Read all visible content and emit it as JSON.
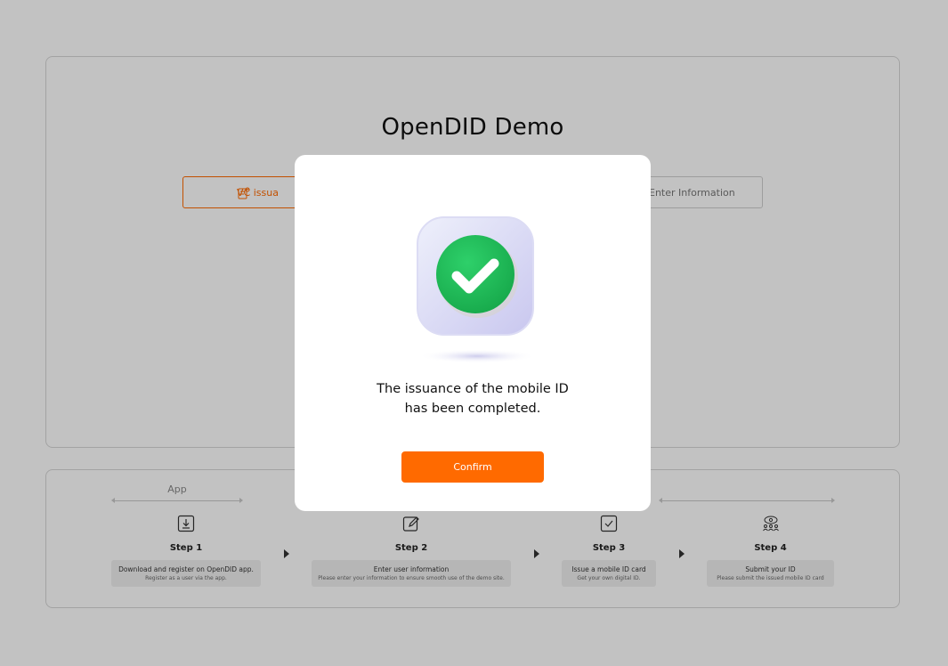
{
  "page": {
    "title": "OpenDID Demo"
  },
  "tabs": [
    {
      "label": "VC issuance",
      "visible_label": "VC issua",
      "active": true
    },
    {
      "label": "Enter Information",
      "active": false
    }
  ],
  "steps_section": {
    "group_label": "App",
    "steps": [
      {
        "title": "Step 1",
        "line1": "Download and register on OpenDID app.",
        "line2": "Register as a user via the app.",
        "icon": "download-icon"
      },
      {
        "title": "Step 2",
        "line1": "Enter user information",
        "line2": "Please enter your information to ensure smooth use of the demo site.",
        "icon": "edit-icon"
      },
      {
        "title": "Step 3",
        "line1": "Issue a mobile ID card",
        "line2": "Get your own digital ID.",
        "icon": "checkbox-icon"
      },
      {
        "title": "Step 4",
        "line1": "Submit your ID",
        "line2": "Please submit the issued mobile ID card",
        "icon": "users-icon"
      }
    ]
  },
  "modal": {
    "message_line1": "The issuance of the mobile ID",
    "message_line2": "has been completed.",
    "confirm_label": "Confirm",
    "icon": "success-check-icon"
  },
  "colors": {
    "accent": "#ff6a00",
    "success": "#1db954",
    "overlay": "rgba(0,0,0,0.24)"
  }
}
